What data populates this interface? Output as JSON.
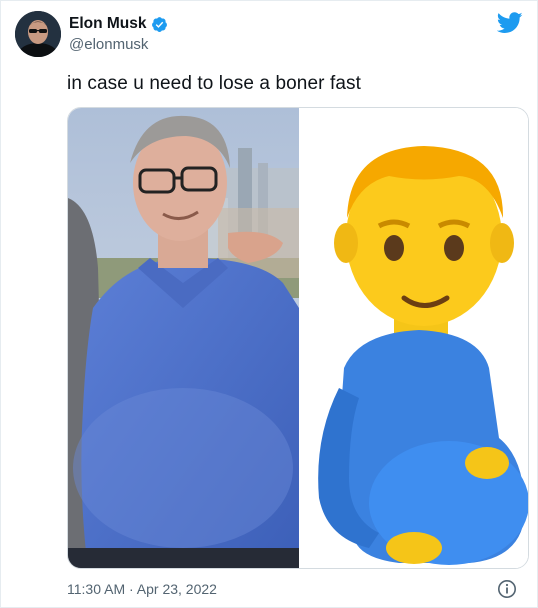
{
  "tweet": {
    "display_name": "Elon Musk",
    "handle": "@elonmusk",
    "text": "in case u need to lose a boner fast",
    "timestamp": "11:30 AM · Apr 23, 2022"
  },
  "media": {
    "left_description_icon": "photo",
    "right_description_icon": "pregnant-man-emoji"
  },
  "colors": {
    "twitter_blue": "#1d9bf0",
    "verified_blue": "#1d9bf0",
    "text_primary": "#0f1419",
    "text_secondary": "#536471"
  }
}
